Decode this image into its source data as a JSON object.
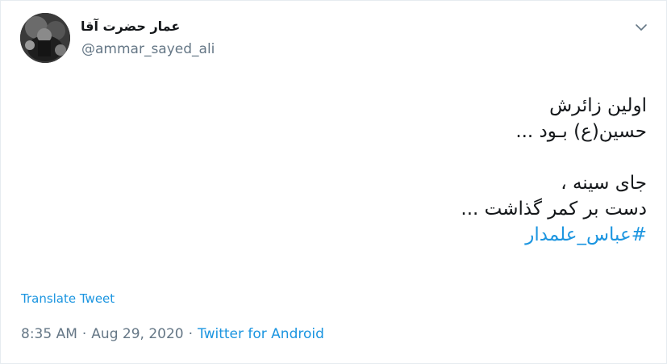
{
  "author": {
    "display_name": "عمار حضرت آقا",
    "username": "@ammar_sayed_ali"
  },
  "tweet": {
    "lines": [
      "اولین زائرش",
      "حسین(ع) بـود ...",
      "",
      "جای سینه ،",
      "دست بر کمر گذاشت ..."
    ],
    "hashtag": "#عباس_علمدار"
  },
  "actions": {
    "translate_label": "Translate Tweet",
    "menu_icon": "chevron-down-icon"
  },
  "meta": {
    "time": "8:35 AM",
    "separator1": "·",
    "date": "Aug 29, 2020",
    "separator2": "·",
    "source": "Twitter for Android"
  },
  "colors": {
    "link": "#1b95e0",
    "muted": "#657786",
    "text": "#14171a",
    "border": "#e6ecf0"
  }
}
